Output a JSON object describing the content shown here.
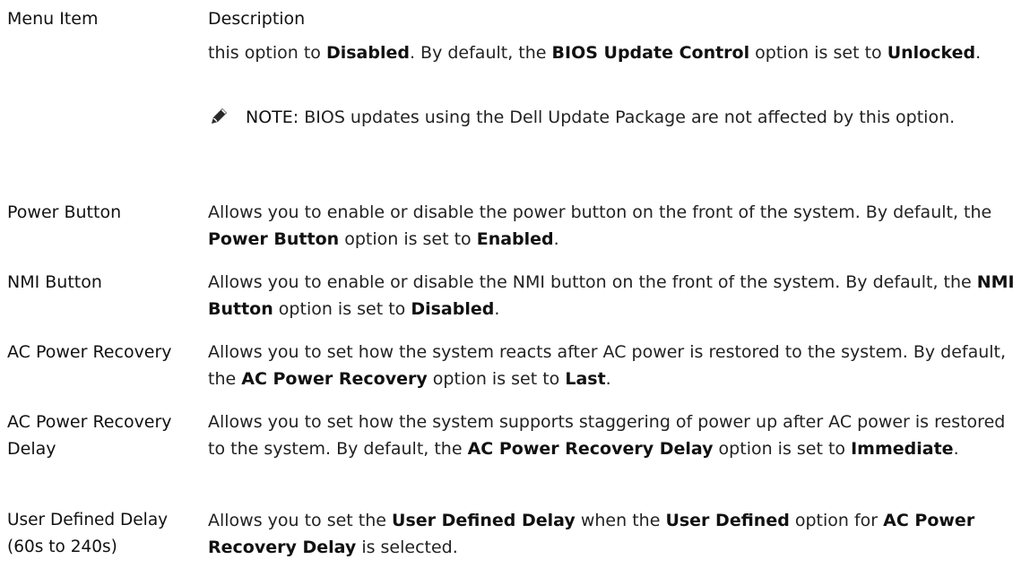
{
  "header": {
    "col_menu": "Menu Item",
    "col_desc": "Description"
  },
  "intro": {
    "t1": "this option to ",
    "b1": "Disabled",
    "t2": ". By default, the ",
    "b2": "BIOS Update Control",
    "t3": " option is set to ",
    "b3": "Unlocked",
    "t4": "."
  },
  "note": {
    "icon": "pencil-note-icon",
    "label": "NOTE:",
    "text": " BIOS updates using the Dell Update Package are not affected by this option."
  },
  "rows": [
    {
      "name": "Power Button",
      "t1": "Allows you to enable or disable the power button on the front of the system. By default, the ",
      "b1": "Power Button",
      "t2": " option is set to ",
      "b2": "Enabled",
      "t3": "."
    },
    {
      "name": "NMI Button",
      "t1": "Allows you to enable or disable the NMI button on the front of the system. By default, the ",
      "b1": "NMI Button",
      "t2": " option is set to ",
      "b2": "Disabled",
      "t3": "."
    },
    {
      "name": "AC Power Recovery",
      "t1": "Allows you to set how the system reacts after AC power is restored to the system. By default, the ",
      "b1": "AC Power Recovery",
      "t2": " option is set to ",
      "b2": "Last",
      "t3": "."
    },
    {
      "name": "AC Power Recovery Delay",
      "t1": "Allows you to set how the system supports staggering of power up after AC power is restored to the system. By default, the ",
      "b1": "AC Power Recovery Delay",
      "t2": " option is set to ",
      "b2": "Immediate",
      "t3": "."
    },
    {
      "name": "User Defined Delay (60s to 240s)",
      "t1": "Allows you to set the ",
      "b1": "User Defined Delay",
      "t2": " when the ",
      "b2": "User Defined",
      "t3": " option for ",
      "b3": "AC Power Recovery Delay",
      "t4": " is selected."
    }
  ]
}
